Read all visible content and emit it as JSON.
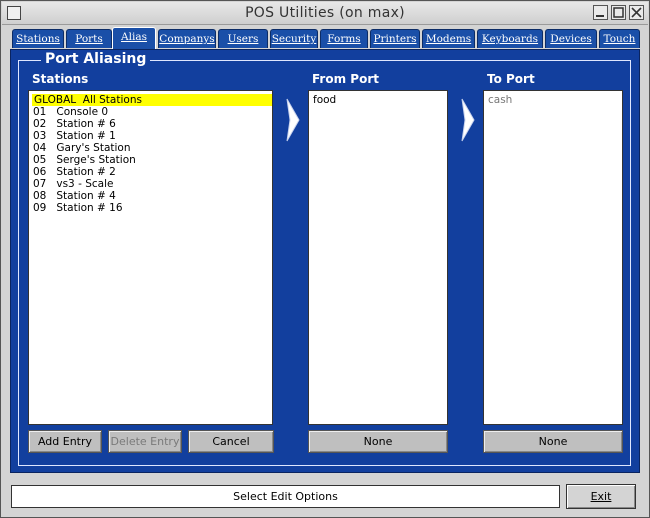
{
  "window": {
    "title": "POS Utilities (on max)"
  },
  "tabs": [
    {
      "label": "Stations",
      "active": false
    },
    {
      "label": "Ports",
      "active": false
    },
    {
      "label": "Alias",
      "active": true
    },
    {
      "label": "Companys",
      "active": false
    },
    {
      "label": "Users",
      "active": false
    },
    {
      "label": "Security",
      "active": false
    },
    {
      "label": "Forms",
      "active": false
    },
    {
      "label": "Printers",
      "active": false
    },
    {
      "label": "Modems",
      "active": false
    },
    {
      "label": "Keyboards",
      "active": false
    },
    {
      "label": "Devices",
      "active": false
    },
    {
      "label": "Touch",
      "active": false
    }
  ],
  "panel": {
    "title": "Port Aliasing",
    "stations_label": "Stations",
    "from_port_label": "From Port",
    "to_port_label": "To Port"
  },
  "stations": [
    {
      "text": "GLOBAL  All Stations",
      "selected": true
    },
    {
      "text": "01   Console 0",
      "selected": false
    },
    {
      "text": "02   Station # 6",
      "selected": false
    },
    {
      "text": "03   Station # 1",
      "selected": false
    },
    {
      "text": "04   Gary's Station",
      "selected": false
    },
    {
      "text": "05   Serge's Station",
      "selected": false
    },
    {
      "text": "06   Station # 2",
      "selected": false
    },
    {
      "text": "07   vs3 - Scale",
      "selected": false
    },
    {
      "text": "08   Station # 4",
      "selected": false
    },
    {
      "text": "09   Station # 16",
      "selected": false
    }
  ],
  "from_port": {
    "value": "food"
  },
  "to_port": {
    "value": "cash"
  },
  "buttons": {
    "add_entry": "Add Entry",
    "delete_entry": "Delete Entry",
    "cancel": "Cancel",
    "from_none": "None",
    "to_none": "None",
    "exit": "Exit"
  },
  "status": {
    "text": "Select Edit Options"
  },
  "colors": {
    "panel_blue": "#123f9e",
    "tab_blue": "#1a4fa8",
    "selection_yellow": "#ffff00"
  }
}
